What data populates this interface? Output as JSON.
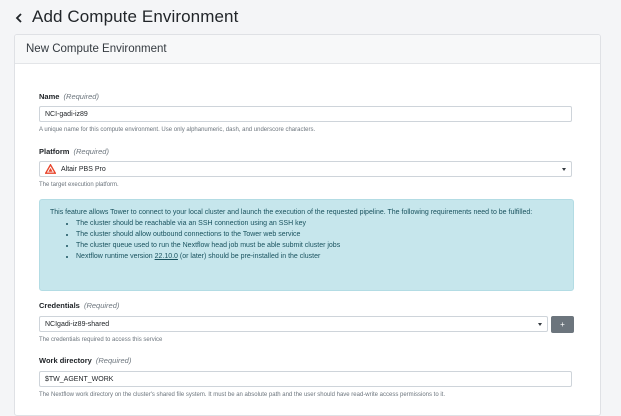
{
  "header": {
    "title": "Add Compute Environment"
  },
  "card": {
    "title": "New Compute Environment"
  },
  "fields": {
    "name": {
      "label": "Name",
      "required": "(Required)",
      "value": "NCI-gadi-iz89",
      "helper": "A unique name for this compute environment. Use only alphanumeric, dash, and underscore characters."
    },
    "platform": {
      "label": "Platform",
      "required": "(Required)",
      "value": "Altair PBS Pro",
      "icon": "altair-pbs-icon",
      "helper": "The target execution platform."
    },
    "credentials": {
      "label": "Credentials",
      "required": "(Required)",
      "value": "NCIgadi-iz89-shared",
      "add_button": "+",
      "helper": "The credentials required to access this service"
    },
    "work_directory": {
      "label": "Work directory",
      "required": "(Required)",
      "value": "$TW_AGENT_WORK",
      "helper": "The Nextflow work directory on the cluster's shared file system. It must be an absolute path and the user should have read-write access permissions to it."
    }
  },
  "info": {
    "intro": "This feature allows Tower to connect to your local cluster and launch the execution of the requested pipeline. The following requirements need to be fulfilled:",
    "items": [
      "The cluster should be reachable via an SSH connection using an SSH key",
      "The cluster should allow outbound connections to the Tower web service",
      "The cluster queue used to run the Nextflow head job must be able submit cluster jobs"
    ],
    "last_prefix": "Nextflow runtime version ",
    "last_version": "22.10.0",
    "last_suffix": " (or later) should be pre-installed in the cluster"
  },
  "colors": {
    "info_bg": "#c6e6ec",
    "info_text": "#19525e",
    "button_bg": "#6c757d",
    "pbs_accent": "#e8452c"
  }
}
